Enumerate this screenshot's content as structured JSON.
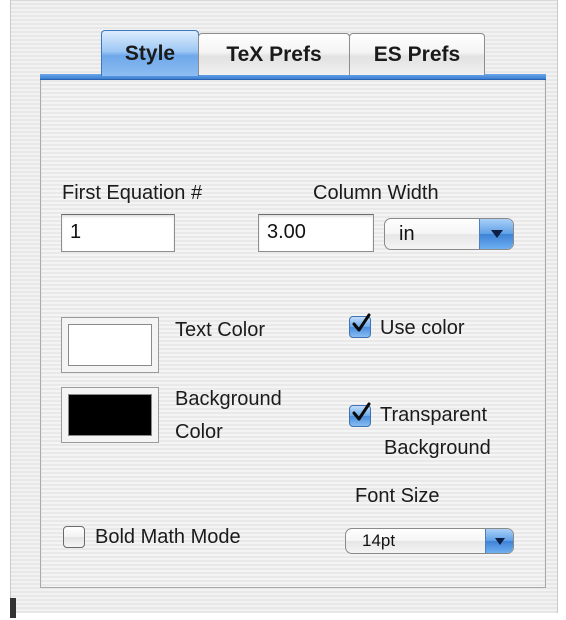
{
  "tabs": [
    {
      "label": "Style",
      "selected": true
    },
    {
      "label": "TeX Prefs",
      "selected": false
    },
    {
      "label": "ES Prefs",
      "selected": false
    }
  ],
  "style": {
    "first_equation": {
      "label": "First Equation #",
      "value": "1"
    },
    "column_width": {
      "label": "Column Width",
      "value": "3.00",
      "unit": "in",
      "unit_options_selected": "in"
    },
    "text_color": {
      "label": "Text Color",
      "swatch": "#ffffff"
    },
    "background_color": {
      "label_line1": "Background",
      "label_line2": "Color",
      "swatch": "#000000"
    },
    "use_color": {
      "label": "Use color",
      "checked": true
    },
    "transparent_background": {
      "label_line1": "Transparent",
      "label_line2": "Background",
      "checked": true
    },
    "font_size": {
      "label": "Font Size",
      "value": "14pt"
    },
    "bold_math_mode": {
      "label": "Bold Math Mode",
      "checked": false
    }
  },
  "colors": {
    "accent": "#4a8ddc",
    "panel_background": "#f0f0f0"
  },
  "icons": {
    "checkmark": "checkmark-icon",
    "popup_arrow": "chevron-down-icon"
  }
}
